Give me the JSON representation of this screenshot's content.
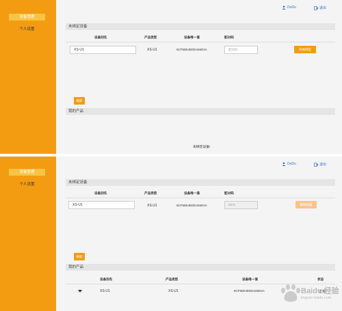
{
  "top": {
    "sidebar": {
      "items": [
        "设备管理",
        "个人设置"
      ]
    },
    "header": {
      "user": "DoDo",
      "logout": "退出"
    },
    "unbound": {
      "title": "未绑定设备",
      "columns": [
        "设备别名",
        "产品类型",
        "设备唯一值",
        "配对码"
      ],
      "row": {
        "alias": "XS-U1",
        "product_type": "XS-U1",
        "device_id": "6CF55E4EDD446D4A",
        "pair_code_placeholder": "配对码",
        "action": "开始绑定"
      },
      "refresh": "刷新"
    },
    "products": {
      "title": "我的产品",
      "empty": "未绑定设备!"
    }
  },
  "bottom": {
    "sidebar": {
      "items": [
        "设备管理",
        "个人设置"
      ]
    },
    "header": {
      "user": "DoDo",
      "logout": "退出"
    },
    "unbound": {
      "title": "未绑定设备",
      "columns": [
        "设备别名",
        "产品类型",
        "设备唯一值",
        "配对码"
      ],
      "row": {
        "alias": "XS-U1",
        "product_type": "XS-U1",
        "device_id": "6CF55E4EDD446D4A",
        "pair_code": "5871",
        "action": "解绑设备"
      },
      "refresh": "刷新"
    },
    "products": {
      "title": "我的产品",
      "columns": [
        "设备别名",
        "产品类型",
        "设备唯一值",
        "状态"
      ],
      "row": {
        "alias": "XS-U1",
        "product_type": "XS-U1",
        "device_id": "6CF55E4EDD446D4A",
        "status": "正常"
      }
    }
  },
  "watermark": {
    "text": "Baidu 经验",
    "sub": "jingyan.baidu.com"
  },
  "colors": {
    "sidebar": "#f39c12",
    "active_item": "#f7c443",
    "link": "#2f74c5",
    "section_bar": "#e5e5e5"
  }
}
